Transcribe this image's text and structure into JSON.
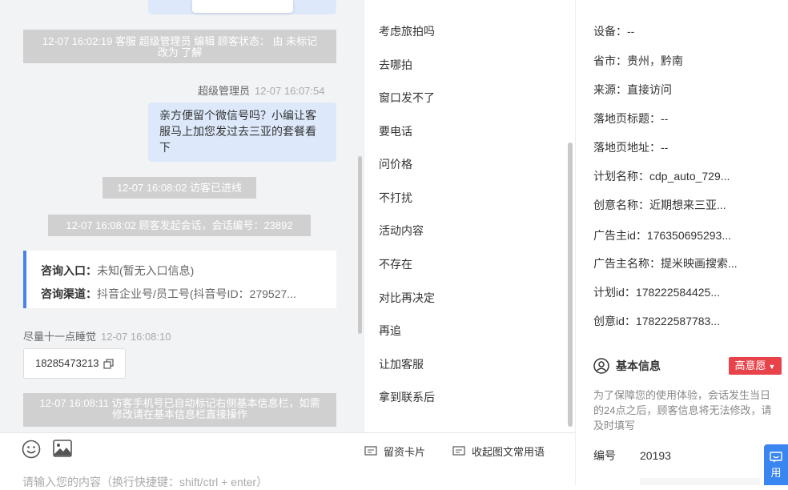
{
  "chat": {
    "messages": {
      "sys1": "12-07 16:02:19 客服 超级管理员 编辑 顾客状态： 由 未标记 改为 了解",
      "agent_name": "超级管理员",
      "agent_time": "12-07 16:07:54",
      "agent_text": "亲方便留个微信号吗？小编让客服马上加您发过去三亚的套餐看下",
      "sys2": "12-07 16:08:02 访客已进线",
      "sys3": "12-07 16:08:02 顾客发起会话，会话编号：23892",
      "info": {
        "entry_label": "咨询入口：",
        "entry_value": "未知(暂无入口信息)",
        "channel_label": "咨询渠道：",
        "channel_value": "抖音企业号/员工号(抖音号ID：279527..."
      },
      "visitor_name": "尽量十一点睡觉",
      "visitor_time": "12-07 16:08:10",
      "phone": "18285473213",
      "sys4": "12-07 16:08:11 访客手机号已自动标记右侧基本信息栏，如需修改请在基本信息栏直接操作"
    }
  },
  "phrases": [
    "考虑旅拍吗",
    "去哪拍",
    "窗口发不了",
    "要电话",
    "问价格",
    "不打扰",
    "活动内容",
    "不存在",
    "对比再决定",
    "再追",
    "让加客服",
    "拿到联系后"
  ],
  "toolbar": {
    "card_label": "留资卡片",
    "collapse_label": "收起图文常用语",
    "placeholder": "请输入您的内容（换行快捷键：shift/ctrl + enter）"
  },
  "source": {
    "rows": [
      {
        "label": "设备：",
        "value": "--"
      },
      {
        "label": "省市：",
        "value": "贵州，黔南"
      },
      {
        "label": "来源：",
        "value": "直接访问"
      },
      {
        "label": "落地页标题：",
        "value": "--"
      },
      {
        "label": "落地页地址：",
        "value": "--"
      },
      {
        "label": "计划名称：",
        "value": "cdp_auto_729..."
      },
      {
        "label": "创意名称：",
        "value": "近期想来三亚..."
      },
      {
        "label": "广告主id：",
        "value": "176350695293..."
      },
      {
        "label": "广告主名称：",
        "value": "提米映画搜索..."
      },
      {
        "label": "计划id：",
        "value": "178222584425..."
      },
      {
        "label": "创意id：",
        "value": "178222587783..."
      }
    ]
  },
  "basic": {
    "title": "基本信息",
    "badge": "高意愿",
    "note": "为了保障您的使用体验，会话发生当日的24点之后，顾客信息将无法修改，请及时填写",
    "id_label": "编号",
    "id_value": "20193"
  },
  "float_btn": "用",
  "colors": {
    "accent": "#4a80e8",
    "badge": "#e8424a",
    "bubble": "#dde9fb"
  }
}
